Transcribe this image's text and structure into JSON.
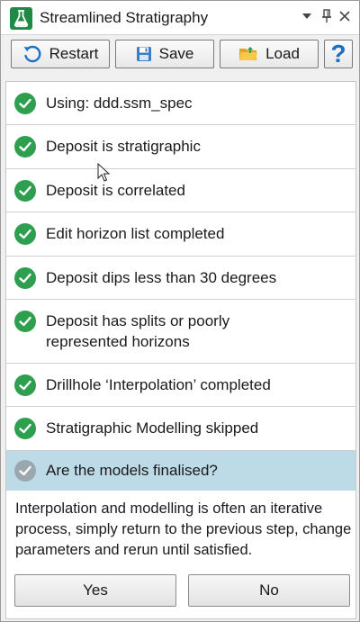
{
  "window": {
    "title": "Streamlined Stratigraphy",
    "icon": "flask-icon",
    "controls": [
      "dropdown-arrow-icon",
      "pin-icon",
      "close-icon"
    ]
  },
  "toolbar": {
    "restart_label": "Restart",
    "save_label": "Save",
    "load_label": "Load",
    "help_label": "?"
  },
  "steps": [
    {
      "label": "Using: ddd.ssm_spec",
      "status": "complete"
    },
    {
      "label": "Deposit is stratigraphic",
      "status": "complete"
    },
    {
      "label": "Deposit is correlated",
      "status": "complete"
    },
    {
      "label": "Edit horizon list completed",
      "status": "complete"
    },
    {
      "label": "Deposit dips less than 30 degrees",
      "status": "complete"
    },
    {
      "label": "Deposit has splits or poorly represented horizons",
      "status": "complete"
    },
    {
      "label": "Drillhole ‘Interpolation’ completed",
      "status": "complete"
    },
    {
      "label": "Stratigraphic Modelling skipped",
      "status": "complete"
    },
    {
      "label": "Are the models finalised?",
      "status": "current"
    }
  ],
  "question": {
    "description": "Interpolation and modelling is often an iterative process, simply return to the previous step, change parameters and rerun until satisfied.",
    "yes_label": "Yes",
    "no_label": "No"
  },
  "colors": {
    "complete": "#2e9e4f",
    "current_row": "#bcdbe6",
    "current_icon": "#9aa8ad"
  }
}
